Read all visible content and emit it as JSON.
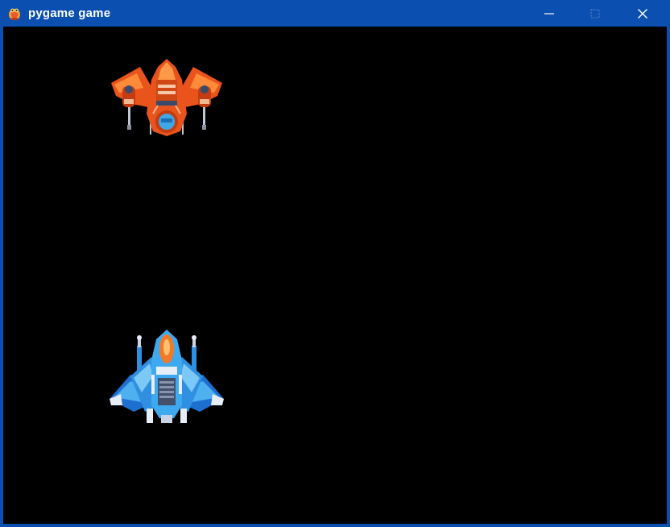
{
  "window": {
    "title": "pygame game",
    "icon": "pygame-snake-icon",
    "controls": {
      "minimize_icon": "minimize-icon",
      "maximize_icon": "maximize-icon",
      "close_icon": "close-icon"
    }
  },
  "game": {
    "background_color": "#000000",
    "sprites": [
      {
        "name": "enemy-ship",
        "color_primary": "#e8541c",
        "color_accent": "#3fa9e6"
      },
      {
        "name": "player-ship",
        "color_primary": "#2f8fe0",
        "color_accent": "#f07a2a"
      }
    ]
  },
  "colors": {
    "titlebar": "#0b4fb0"
  }
}
